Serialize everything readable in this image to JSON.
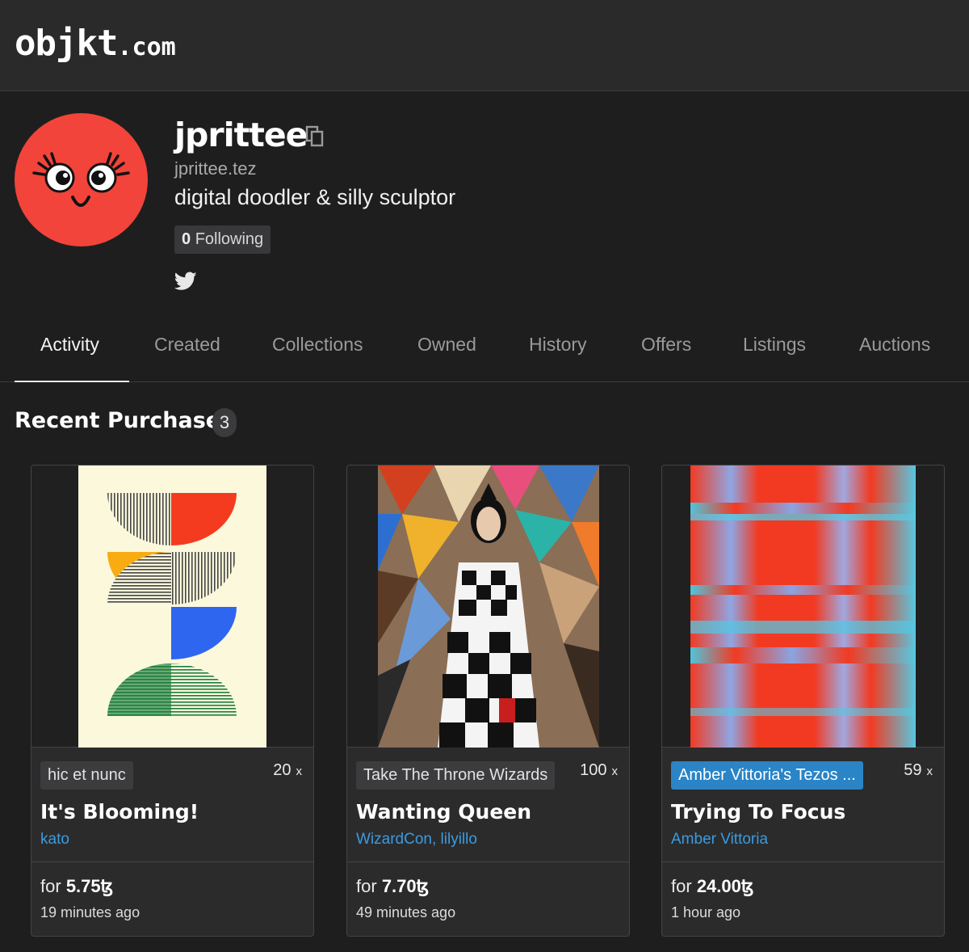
{
  "header": {
    "logo_main": "objkt",
    "logo_suffix": ".com"
  },
  "profile": {
    "username": "jprittee",
    "tez_domain": "jprittee.tez",
    "bio": "digital doodler & silly sculptor",
    "following_count": "0",
    "following_label": "Following"
  },
  "tabs": [
    {
      "label": "Activity",
      "active": true
    },
    {
      "label": "Created"
    },
    {
      "label": "Collections"
    },
    {
      "label": "Owned"
    },
    {
      "label": "History"
    },
    {
      "label": "Offers"
    },
    {
      "label": "Listings"
    },
    {
      "label": "Auctions"
    }
  ],
  "section": {
    "title": "Recent Purchases",
    "count": "3"
  },
  "cards": [
    {
      "collection": "hic et nunc",
      "editions": "20",
      "x": "x",
      "title": "It's Blooming!",
      "creator": "kato",
      "price_prefix": "for",
      "price": "5.75",
      "currency": "ꜩ",
      "time": "19 minutes ago"
    },
    {
      "collection": "Take The Throne Wizards",
      "editions": "100",
      "x": "x",
      "title": "Wanting Queen",
      "creator": "WizardCon, lilyillo",
      "price_prefix": "for",
      "price": "7.70",
      "currency": "ꜩ",
      "time": "49 minutes ago"
    },
    {
      "collection": "Amber Vittoria's Tezos ...",
      "editions": "59",
      "x": "x",
      "title": "Trying To Focus",
      "creator": "Amber Vittoria",
      "price_prefix": "for",
      "price": "24.00",
      "currency": "ꜩ",
      "time": "1 hour ago"
    }
  ],
  "colors": {
    "accent_link": "#3b9be0",
    "collection_badge_blue": "#2a84c6",
    "avatar_bg": "#f2443a"
  }
}
